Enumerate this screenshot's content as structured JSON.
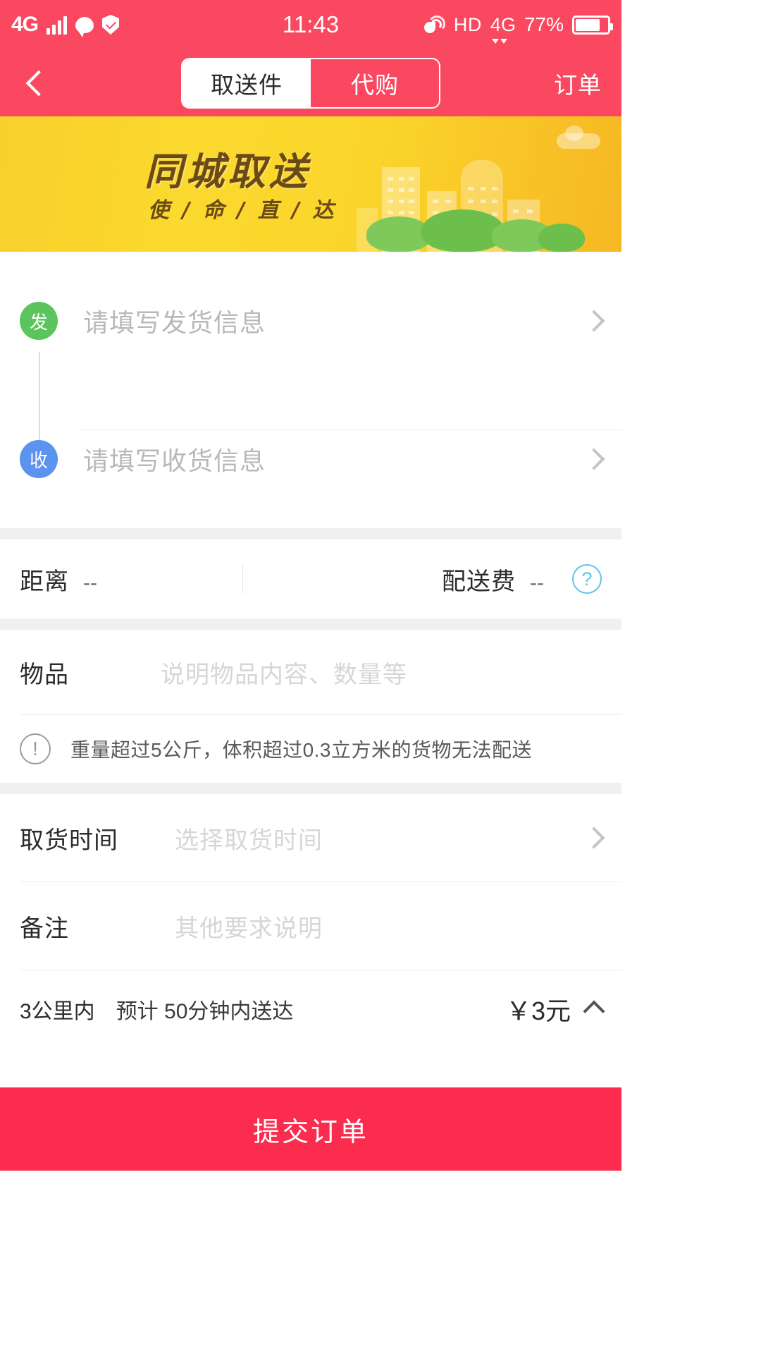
{
  "statusbar": {
    "network": "4G",
    "time": "11:43",
    "hd": "HD",
    "network2": "4G",
    "battery_pct": "77%",
    "icons": [
      "signal-bars-icon",
      "chat-bubble-icon",
      "shield-check-icon",
      "mute-icon",
      "battery-icon"
    ]
  },
  "navbar": {
    "back": "back-chevron-icon",
    "tabs": [
      {
        "label": "取送件",
        "active": true
      },
      {
        "label": "代购",
        "active": false
      }
    ],
    "right_action": "订单"
  },
  "banner": {
    "title": "同城取送",
    "subtitle": "使 / 命 / 直 / 达",
    "bg_color": "#fbd52b",
    "text_color": "#6b4a18"
  },
  "address": {
    "sender": {
      "badge": "发",
      "badge_color": "#5cc45c",
      "placeholder": "请填写发货信息"
    },
    "receiver": {
      "badge": "收",
      "badge_color": "#5b93ef",
      "placeholder": "请填写收货信息"
    }
  },
  "summary": {
    "distance_label": "距离",
    "distance_value": "--",
    "fee_label": "配送费",
    "fee_value": "--",
    "help_icon": "question-mark-icon"
  },
  "item": {
    "label": "物品",
    "placeholder": "说明物品内容、数量等"
  },
  "warning": {
    "icon": "exclamation-icon",
    "text": "重量超过5公斤，体积超过0.3立方米的货物无法配送"
  },
  "pickup_time": {
    "label": "取货时间",
    "placeholder": "选择取货时间"
  },
  "remark": {
    "label": "备注",
    "placeholder": "其他要求说明"
  },
  "price_summary": {
    "range": "3公里内",
    "eta": "预计 50分钟内送达",
    "amount": "￥3元",
    "expand_icon": "chevron-up-icon"
  },
  "submit": {
    "label": "提交订单",
    "color": "#fb2c4e"
  }
}
